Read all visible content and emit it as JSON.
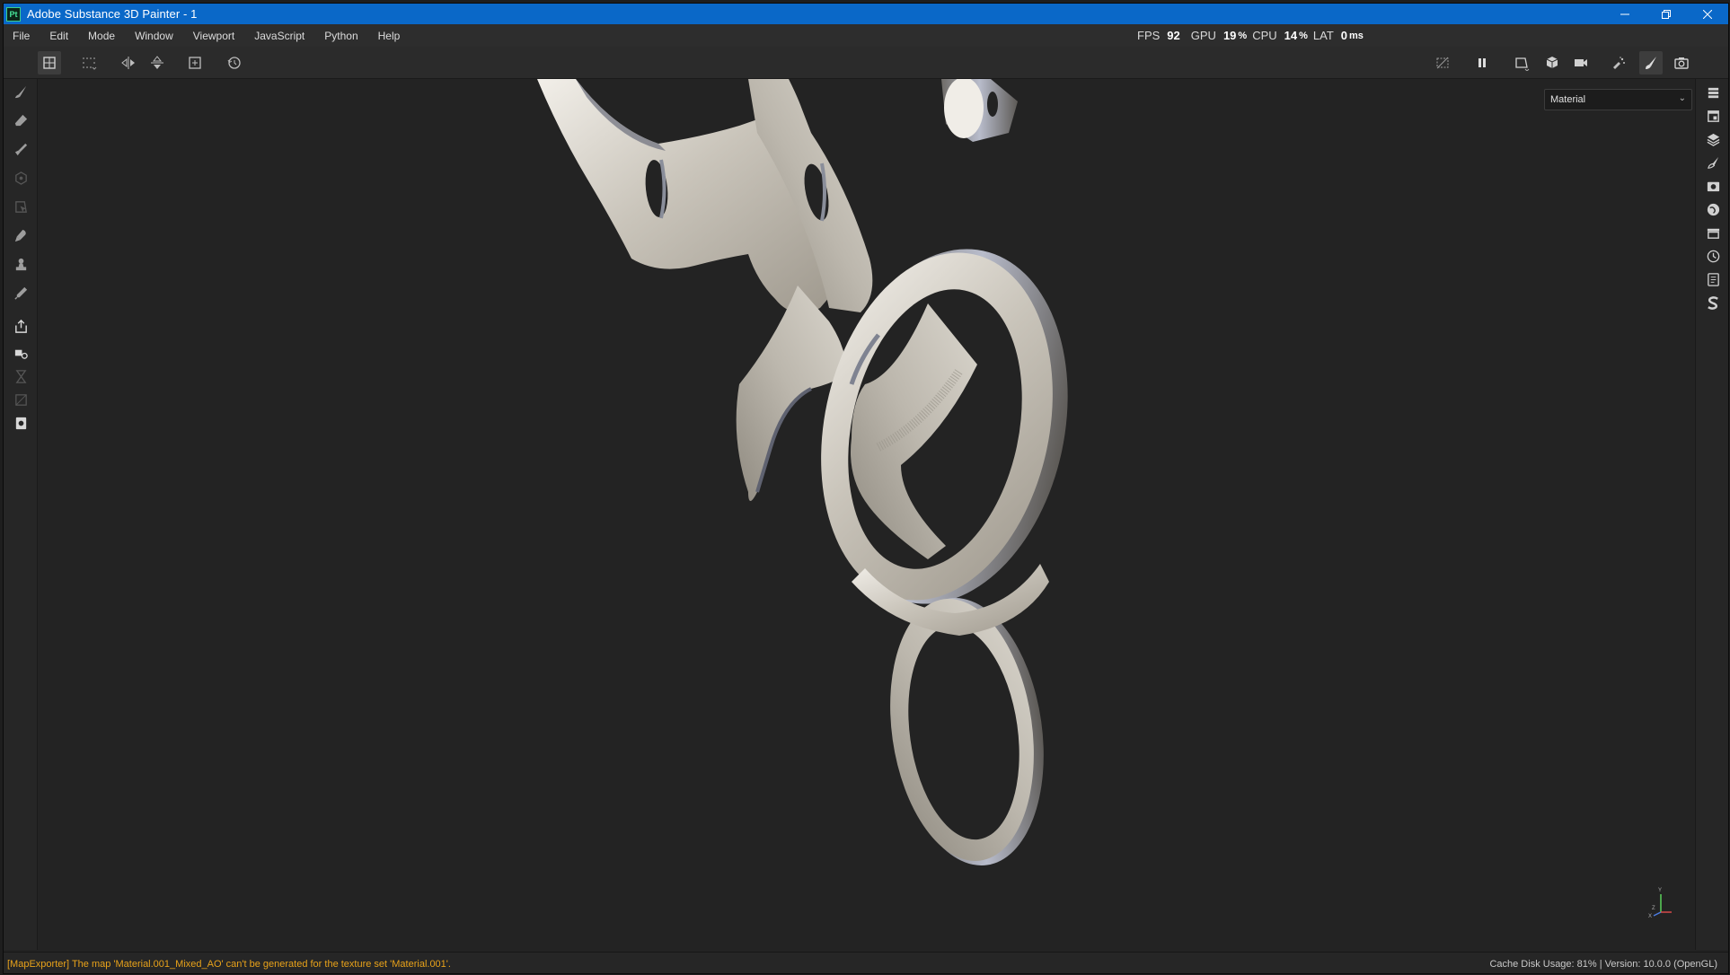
{
  "window": {
    "title": "Adobe Substance 3D Painter - 1",
    "logo": "Pt",
    "controls": {
      "minimize_icon": "minimize-icon",
      "restore_icon": "restore-icon",
      "close_icon": "close-icon"
    }
  },
  "menu": [
    "File",
    "Edit",
    "Mode",
    "Window",
    "Viewport",
    "JavaScript",
    "Python",
    "Help"
  ],
  "perf": {
    "fps_label": "FPS",
    "fps_value": "92",
    "gpu_label": "GPU",
    "gpu_value": "19",
    "gpu_unit": "%",
    "cpu_label": "CPU",
    "cpu_value": "14",
    "cpu_unit": "%",
    "lat_label": "LAT",
    "lat_value": "0",
    "lat_unit": "ms"
  },
  "toolbar": {
    "left": [
      "uv-tiles-icon",
      "grid-icon",
      "mirror-x-icon",
      "mirror-y-icon",
      "add-frame-icon",
      "reset-icon"
    ],
    "right": [
      "hide-icon",
      "pause-icon",
      "viewport-2d-icon",
      "cube-icon",
      "camera-icon",
      "brush-spread-icon",
      "paint-brush-icon",
      "screenshot-icon"
    ]
  },
  "left_tools": [
    "paint-icon",
    "eraser-icon",
    "projection-icon",
    "geometry-mask-icon",
    "polygon-fill-icon",
    "smudge-icon",
    "clone-icon",
    "color-picker-icon",
    "bake-icon",
    "material-picker-icon",
    "hourglass-icon",
    "uv-disabled-icon",
    "export-icon"
  ],
  "right_dock": [
    "layers-stack-icon",
    "texture-set-icon",
    "layers-icon",
    "brush-settings-icon",
    "display-settings-icon",
    "environment-icon",
    "assets-icon",
    "history-icon",
    "log-icon",
    "substance-icon"
  ],
  "viewport": {
    "mode_value": "Material",
    "gizmo_axes": {
      "y": "Y",
      "z": "Z",
      "x": "X"
    },
    "colors": {
      "background": "#232323",
      "metal": "#c8c4bb"
    }
  },
  "status": {
    "message": "[MapExporter] The map 'Material.001_Mixed_AO' can't be generated for the texture set 'Material.001'.",
    "right": "Cache Disk Usage:   81% | Version: 10.0.0 (OpenGL)"
  }
}
